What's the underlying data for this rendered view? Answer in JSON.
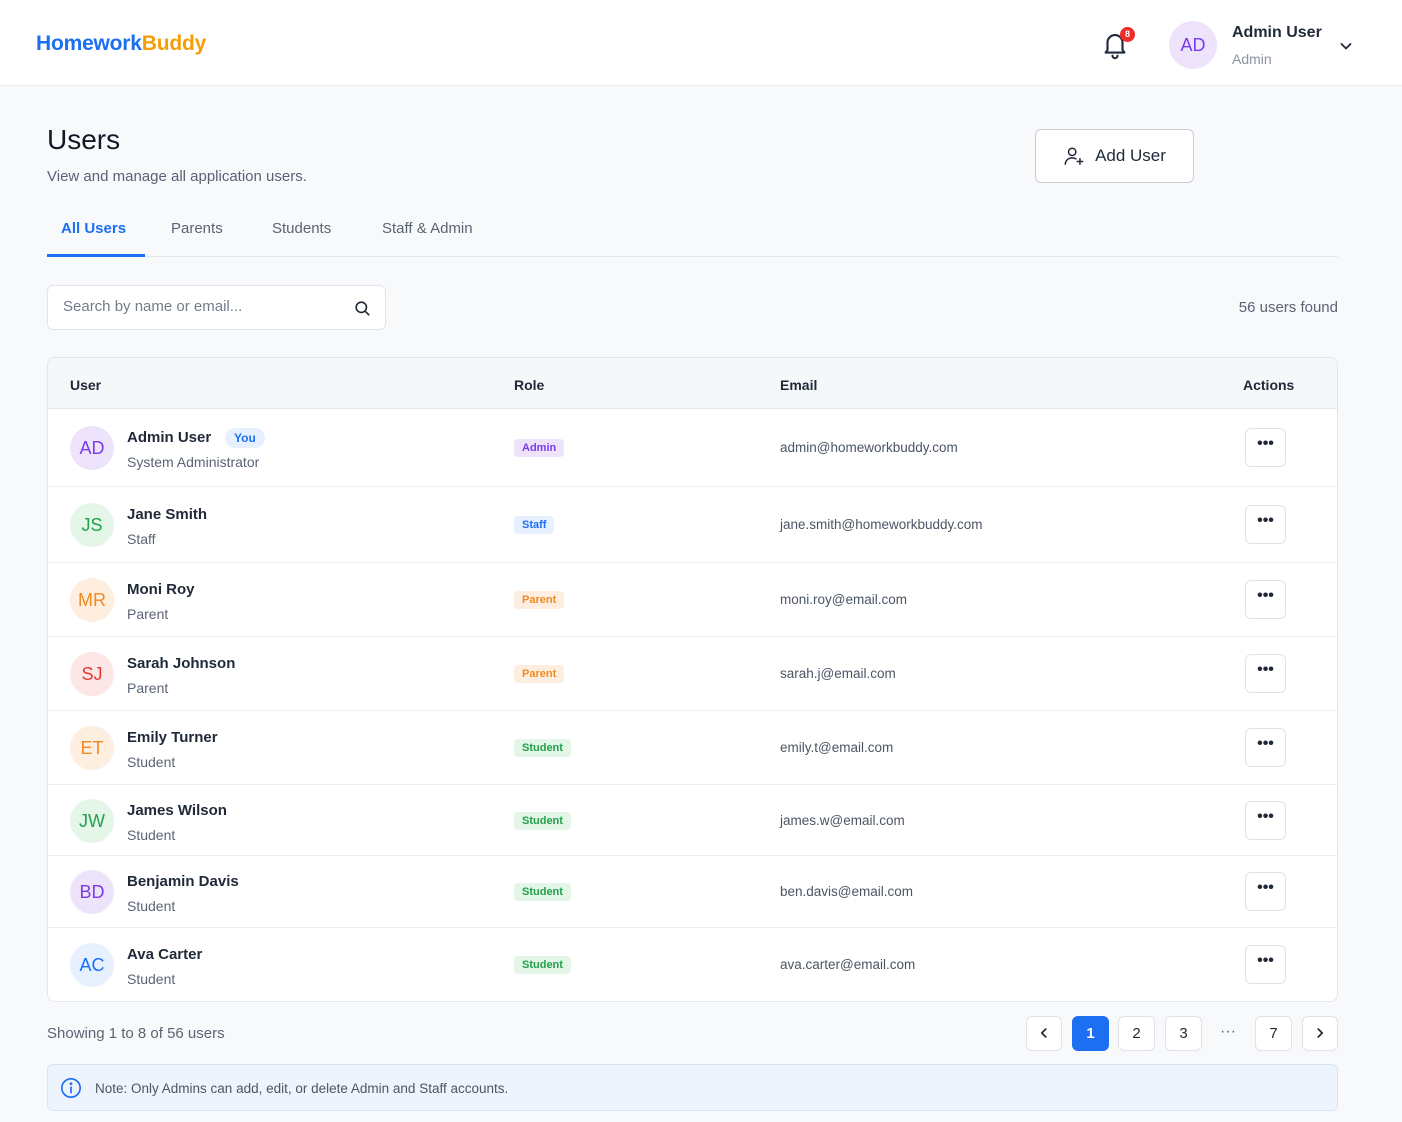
{
  "brand": {
    "part1": "Homework",
    "part2": "Buddy",
    "color1": "#1d6ff2",
    "color2": "#f59e0b"
  },
  "header": {
    "notification_count": "8",
    "user_initials": "AD",
    "user_name": "Admin User",
    "user_role": "Admin"
  },
  "page": {
    "title": "Users",
    "subtitle": "View and manage all application users.",
    "add_button": "Add User"
  },
  "tabs": [
    {
      "label": "All Users",
      "active": true
    },
    {
      "label": "Parents",
      "active": false
    },
    {
      "label": "Students",
      "active": false
    },
    {
      "label": "Staff & Admin",
      "active": false
    }
  ],
  "search": {
    "placeholder": "Search by name or email...",
    "value": ""
  },
  "results_count": "56 users found",
  "table": {
    "columns": [
      "User",
      "Role",
      "Email",
      "Actions"
    ],
    "rows": [
      {
        "initials": "AD",
        "name": "Admin User",
        "sub": "System Administrator",
        "you": "You",
        "role": "Admin",
        "email": "admin@homeworkbuddy.com",
        "action": "•••",
        "avatar_bg": "#ede4fb",
        "avatar_fg": "#7c3aed"
      },
      {
        "initials": "JS",
        "name": "Jane Smith",
        "sub": "Staff",
        "you": "",
        "role": "Staff",
        "email": "jane.smith@homeworkbuddy.com",
        "action": "•••",
        "avatar_bg": "#e3f6e8",
        "avatar_fg": "#22a04a"
      },
      {
        "initials": "MR",
        "name": "Moni Roy",
        "sub": "Parent",
        "you": "",
        "role": "Parent",
        "email": "moni.roy@email.com",
        "action": "•••",
        "avatar_bg": "#fdeee0",
        "avatar_fg": "#f08a24"
      },
      {
        "initials": "SJ",
        "name": "Sarah Johnson",
        "sub": "Parent",
        "you": "",
        "role": "Parent",
        "email": "sarah.j@email.com",
        "action": "•••",
        "avatar_bg": "#fde6e6",
        "avatar_fg": "#e53935"
      },
      {
        "initials": "ET",
        "name": "Emily Turner",
        "sub": "Student",
        "you": "",
        "role": "Student",
        "email": "emily.t@email.com",
        "action": "•••",
        "avatar_bg": "#fdeee0",
        "avatar_fg": "#f08a24"
      },
      {
        "initials": "JW",
        "name": "James Wilson",
        "sub": "Student",
        "you": "",
        "role": "Student",
        "email": "james.w@email.com",
        "action": "•••",
        "avatar_bg": "#e3f6e8",
        "avatar_fg": "#22a04a"
      },
      {
        "initials": "BD",
        "name": "Benjamin Davis",
        "sub": "Student",
        "you": "",
        "role": "Student",
        "email": "ben.davis@email.com",
        "action": "•••",
        "avatar_bg": "#ede4fb",
        "avatar_fg": "#7c3aed"
      },
      {
        "initials": "AC",
        "name": "Ava Carter",
        "sub": "Student",
        "you": "",
        "role": "Student",
        "email": "ava.carter@email.com",
        "action": "•••",
        "avatar_bg": "#e6f0ff",
        "avatar_fg": "#1d6ff2"
      }
    ]
  },
  "role_colors": {
    "Admin": {
      "bg": "#ede4fb",
      "fg": "#7c3aed"
    },
    "Staff": {
      "bg": "#e6f0ff",
      "fg": "#1d6ff2"
    },
    "Parent": {
      "bg": "#fdeee0",
      "fg": "#f08a24"
    },
    "Student": {
      "bg": "#e3f6e8",
      "fg": "#22a04a"
    }
  },
  "pagination": {
    "summary": "Showing 1 to 8 of 56 users",
    "pages": [
      "1",
      "2",
      "3",
      "7"
    ],
    "current": "1",
    "ellipsis": "···"
  },
  "note": "Note: Only Admins can add, edit, or delete Admin and Staff accounts."
}
